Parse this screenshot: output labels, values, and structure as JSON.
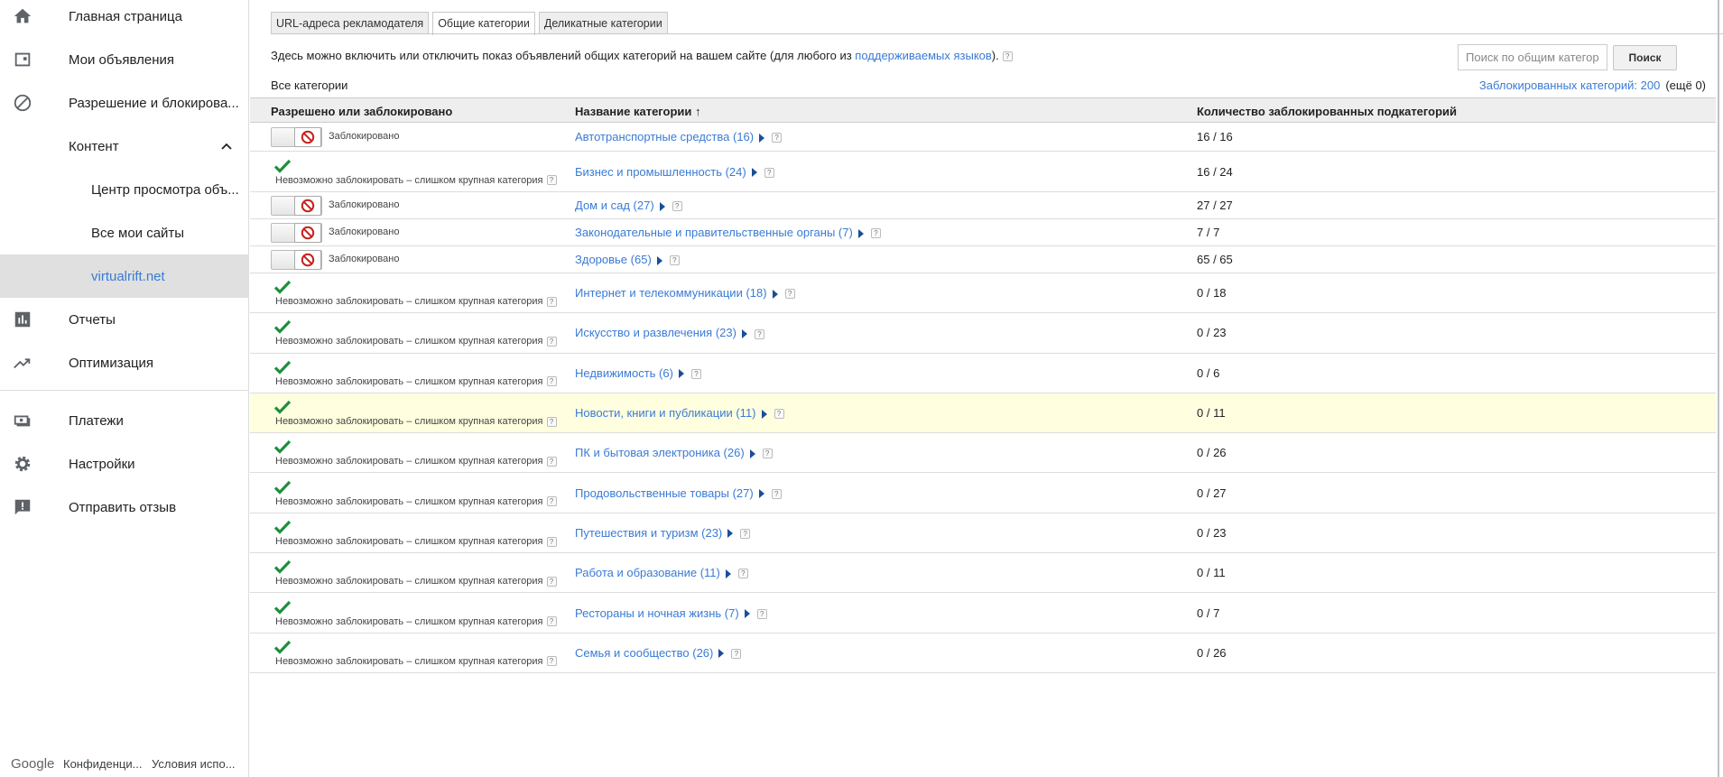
{
  "sidebar": {
    "home": "Главная страница",
    "ads": "Мои объявления",
    "allow_block": "Разрешение и блокирова...",
    "content": "Контент",
    "ad_review": "Центр просмотра объ...",
    "all_sites": "Все мои сайты",
    "site": "virtualrift.net",
    "reports": "Отчеты",
    "optimization": "Оптимизация",
    "payments": "Платежи",
    "settings": "Настройки",
    "feedback": "Отправить отзыв",
    "footer": {
      "google": "Google",
      "privacy": "Конфиденци...",
      "terms": "Условия испо..."
    }
  },
  "tabs": [
    "URL-адреса рекламодателя",
    "Общие категории",
    "Деликатные категории"
  ],
  "intro": {
    "text": "Здесь можно включить или отключить показ объявлений общих категорий на вашем сайте (для любого из ",
    "link": "поддерживаемых языков",
    "tail": ")."
  },
  "search": {
    "placeholder": "Поиск по общим категориям",
    "button": "Поиск"
  },
  "all_categories": "Все категории",
  "blocked_summary": {
    "link": "Заблокированных категорий: 200",
    "more": "(ещё 0)"
  },
  "columns": {
    "status": "Разрешено или заблокировано",
    "name": "Название категории",
    "sort_icon": "↑",
    "count": "Количество заблокированных подкатегорий"
  },
  "status_labels": {
    "blocked": "Заблокировано",
    "cant_block": "Невозможно заблокировать – слишком крупная категория"
  },
  "rows": [
    {
      "status": "blocked",
      "name": "Автотранспортные средства (16)",
      "count": "16 / 16"
    },
    {
      "status": "allowed",
      "name": "Бизнес и промышленность (24)",
      "count": "16 / 24"
    },
    {
      "status": "blocked",
      "name": "Дом и сад (27)",
      "count": "27 / 27"
    },
    {
      "status": "blocked",
      "name": "Законодательные и правительственные органы (7)",
      "count": "7 / 7"
    },
    {
      "status": "blocked",
      "name": "Здоровье (65)",
      "count": "65 / 65"
    },
    {
      "status": "allowed",
      "name": "Интернет и телекоммуникации (18)",
      "count": "0 / 18"
    },
    {
      "status": "allowed",
      "name": "Искусство и развлечения (23)",
      "count": "0 / 23"
    },
    {
      "status": "allowed",
      "name": "Недвижимость (6)",
      "count": "0 / 6"
    },
    {
      "status": "allowed",
      "name": "Новости, книги и публикации (11)",
      "count": "0 / 11",
      "highlight": true
    },
    {
      "status": "allowed",
      "name": "ПК и бытовая электроника (26)",
      "count": "0 / 26"
    },
    {
      "status": "allowed",
      "name": "Продовольственные товары (27)",
      "count": "0 / 27"
    },
    {
      "status": "allowed",
      "name": "Путешествия и туризм (23)",
      "count": "0 / 23"
    },
    {
      "status": "allowed",
      "name": "Работа и образование (11)",
      "count": "0 / 11"
    },
    {
      "status": "allowed",
      "name": "Рестораны и ночная жизнь (7)",
      "count": "0 / 7"
    },
    {
      "status": "allowed",
      "name": "Семья и сообщество (26)",
      "count": "0 / 26"
    }
  ],
  "colors": {
    "link": "#3a7bd5",
    "check": "#1e8e3e",
    "block": "#c5221f",
    "highlight": "#ffffe0"
  }
}
